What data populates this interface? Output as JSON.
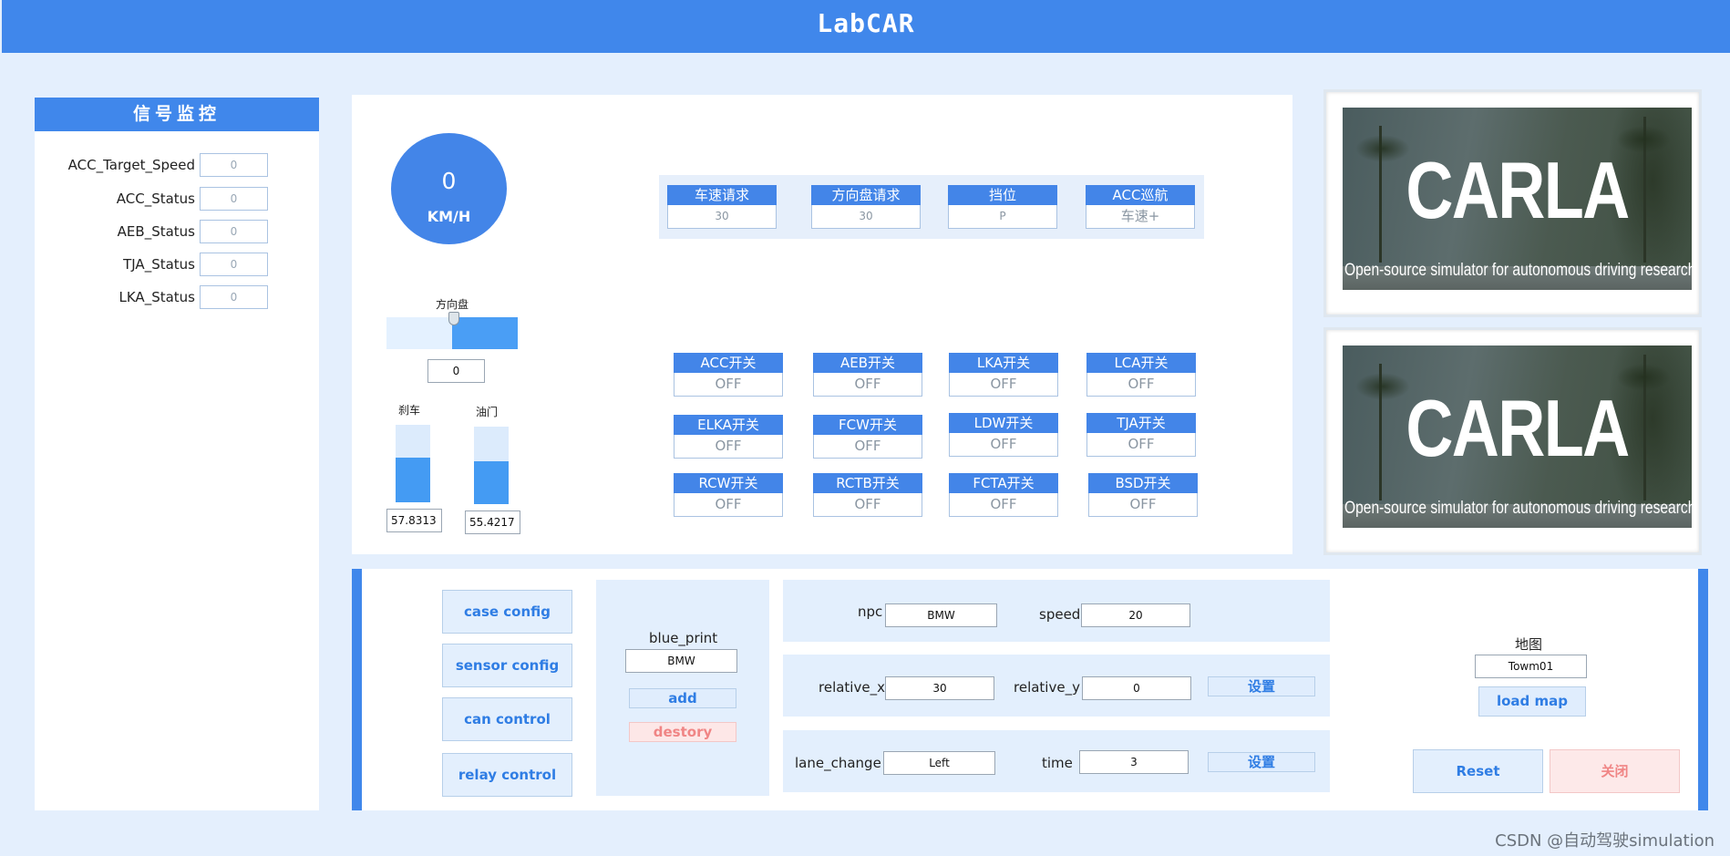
{
  "app": {
    "title": "LabCAR"
  },
  "monitor": {
    "title": "信号监控",
    "items": [
      {
        "label": "ACC_Target_Speed",
        "value": "0"
      },
      {
        "label": "ACC_Status",
        "value": "0"
      },
      {
        "label": "AEB_Status",
        "value": "0"
      },
      {
        "label": "TJA_Status",
        "value": "0"
      },
      {
        "label": "LKA_Status",
        "value": "0"
      }
    ]
  },
  "dashboard": {
    "speed_value": "0",
    "speed_unit": "KM/H",
    "steering": {
      "label": "方向盘",
      "value": "0",
      "level": 0.5
    },
    "brake": {
      "label": "刹车",
      "value": "57.8313",
      "fill_fraction": 0.578313
    },
    "throttle": {
      "label": "油门",
      "value": "55.4217",
      "fill_fraction": 0.554217
    }
  },
  "requests": [
    {
      "label": "车速请求",
      "value": "30"
    },
    {
      "label": "方向盘请求",
      "value": "30"
    },
    {
      "label": "挡位",
      "value": "P"
    },
    {
      "label": "ACC巡航",
      "value": "车速+"
    }
  ],
  "switches": [
    {
      "label": "ACC开关",
      "value": "OFF"
    },
    {
      "label": "AEB开关",
      "value": "OFF"
    },
    {
      "label": "LKA开关",
      "value": "OFF"
    },
    {
      "label": "LCA开关",
      "value": "OFF"
    },
    {
      "label": "ELKA开关",
      "value": "OFF"
    },
    {
      "label": "FCW开关",
      "value": "OFF"
    },
    {
      "label": "LDW开关",
      "value": "OFF"
    },
    {
      "label": "TJA开关",
      "value": "OFF"
    },
    {
      "label": "RCW开关",
      "value": "OFF"
    },
    {
      "label": "RCTB开关",
      "value": "OFF"
    },
    {
      "label": "FCTA开关",
      "value": "OFF"
    },
    {
      "label": "BSD开关",
      "value": "OFF"
    }
  ],
  "carla": {
    "logo": "CARLA",
    "tagline": "Open-source simulator for autonomous driving research."
  },
  "config_buttons": {
    "case": "case config",
    "sensor": "sensor config",
    "can": "can control",
    "relay": "relay control"
  },
  "blueprint": {
    "label": "blue_print",
    "value": "BMW",
    "add": "add",
    "destroy": "destory"
  },
  "npc": {
    "npc_label": "npc",
    "npc_value": "BMW",
    "speed_label": "speed",
    "speed_value": "20",
    "rel_x_label": "relative_x",
    "rel_x_value": "30",
    "rel_y_label": "relative_y",
    "rel_y_value": "0",
    "set1": "设置",
    "lane_label": "lane_change",
    "lane_value": "Left",
    "time_label": "time",
    "time_value": "3",
    "set2": "设置"
  },
  "map": {
    "label": "地图",
    "value": "Towm01",
    "load": "load map",
    "reset": "Reset",
    "close": "关闭"
  },
  "watermark": "CSDN @自动驾驶simulation"
}
